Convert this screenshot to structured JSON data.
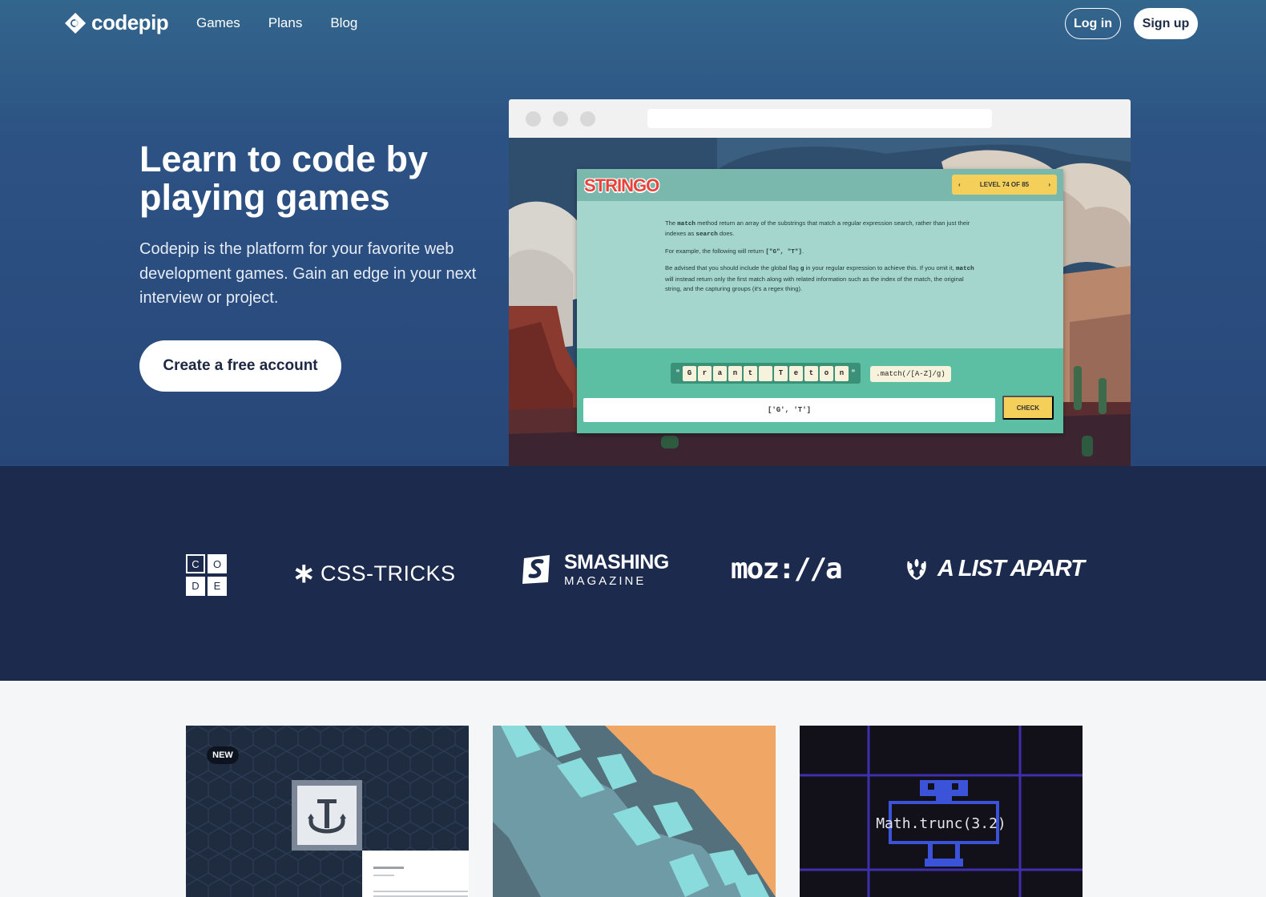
{
  "brand": {
    "name": "codepip",
    "icon": "codepip-logo-icon"
  },
  "nav": {
    "links": [
      {
        "label": "Games"
      },
      {
        "label": "Plans"
      },
      {
        "label": "Blog"
      }
    ],
    "login_label": "Log in",
    "signup_label": "Sign up"
  },
  "hero": {
    "title": "Learn to code by playing games",
    "subtitle": "Codepip is the platform for your favorite web development games. Gain an edge in your next interview or project.",
    "cta_label": "Create a free account"
  },
  "game_preview": {
    "name": "STRINGO",
    "level_label": "LEVEL 74 OF 85",
    "paragraph_1_a": "The ",
    "paragraph_1_code": "match",
    "paragraph_1_b": " method return an array of the substrings that match a regular expression search, rather than just their indexes as ",
    "paragraph_1_code2": "search",
    "paragraph_1_c": " does.",
    "paragraph_2_a": "For example, the following will return ",
    "paragraph_2_code": "[\"G\", \"T\"]",
    "paragraph_2_b": ".",
    "paragraph_3_a": "Be advised that you should include the global flag ",
    "paragraph_3_code": "g",
    "paragraph_3_b": " in your regular expression to achieve this. If you omit it, ",
    "paragraph_3_code2": "match",
    "paragraph_3_c": " will instead return only the first match along with related information such as the index of the match, the original string, and the capturing groups (it's a regex thing).",
    "characters": [
      "G",
      "r",
      "a",
      "n",
      "t",
      " ",
      "T",
      "e",
      "t",
      "o",
      "n"
    ],
    "quote_char": "\"",
    "method_call": ".match(/[A-Z]/g)",
    "answer": "['G', 'T']",
    "check_label": "CHECK"
  },
  "partners": {
    "code_org_letters": [
      "C",
      "O",
      "D",
      "E"
    ],
    "css_tricks": "CSS-TRICKS",
    "smashing_top": "SMASHING",
    "smashing_bottom": "MAGAZINE",
    "mozilla": "moz://a",
    "a_list_apart": "A LIST APART"
  },
  "cards": {
    "badge": "NEW",
    "math_label": "Math.trunc(3.2)"
  },
  "colors": {
    "hero_top": "#33668d",
    "hero_bottom": "#284779",
    "partners_bg": "#1c2b4d",
    "page_bg": "#f5f6f8"
  }
}
